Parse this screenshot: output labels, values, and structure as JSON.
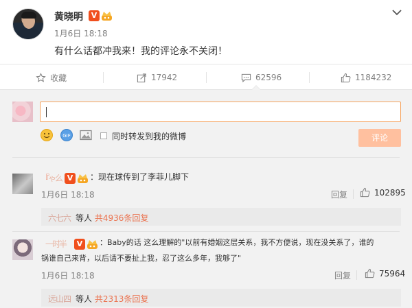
{
  "post": {
    "author": "黄晓明",
    "time": "1月6日 18:18",
    "text": "有什么话都冲我来！我的评论永不关闭！",
    "verified_badge": "V"
  },
  "actions": {
    "favorite_label": "收藏",
    "repost_count": "17942",
    "comment_count": "62596",
    "like_count": "1184232"
  },
  "compose": {
    "input_value": "",
    "share_label": "同时转发到我的微博",
    "submit_label": "评论"
  },
  "comments": [
    {
      "name": "『",
      "name_blurred": "ゃ么",
      "text": "：现在球传到了李菲儿脚下",
      "time": "1月6日 18:18",
      "reply_label": "回复",
      "likes": "102895",
      "sub_users": "六七六",
      "sub_suffix": " 等人 ",
      "sub_link": "共4936条回复"
    },
    {
      "name": "　　",
      "name_blurred": "一时半",
      "text_line1": "：Baby的话 这么理解的\"以前有婚姻这层关系，我不方便说，现在没关系了，谁的",
      "text_line2": "锅谁自己来背，以后请不要扯上我，忍了这么多年，我够了\"",
      "time": "1月6日 18:18",
      "reply_label": "回复",
      "likes": "75964",
      "sub_users": "远山四",
      "sub_suffix": " 等人 ",
      "sub_link": "共2313条回复"
    }
  ],
  "colors": {
    "accent_orange": "#eb7350",
    "verified_red": "#f04f1d",
    "input_border": "#f5a05a",
    "submit_bg": "#ffc09f"
  }
}
